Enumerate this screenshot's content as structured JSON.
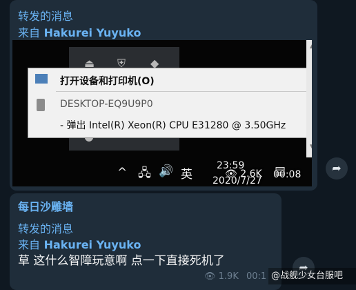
{
  "colors": {
    "background": "#0f1821",
    "bubble": "#1f2d3a",
    "accent": "#6ab3f3"
  },
  "message1": {
    "forwarded_label": "转发的消息",
    "from_prefix": "来自",
    "from_name": "Hakurei Yuyuko",
    "video": {
      "tray_icons": [
        "usb-icon",
        "shield-icon",
        "volume-icon",
        "app-icon"
      ],
      "context_menu": {
        "item1": "打开设备和打印机(O)",
        "item2": "DESKTOP-EQ9U9P0",
        "item3": "- 弹出 Intel(R) Xeon(R) CPU E31280 @ 3.50GHz"
      },
      "taskbar": {
        "chevron": "^",
        "ime": "英",
        "time": "23:59",
        "date": "2020/7/27"
      },
      "views": "2.6K",
      "duration": "00:08"
    },
    "share_icon": "share-arrow-icon"
  },
  "message2": {
    "channel": "每日沙雕墙",
    "forwarded_label": "转发的消息",
    "from_prefix": "来自",
    "from_name": "Hakurei Yuyuko",
    "text": "草 这什么智障玩意啊 点一下直接死机了",
    "views": "1.9K",
    "time_partial": "00:1"
  },
  "watermark": "@战舰少女台服吧"
}
